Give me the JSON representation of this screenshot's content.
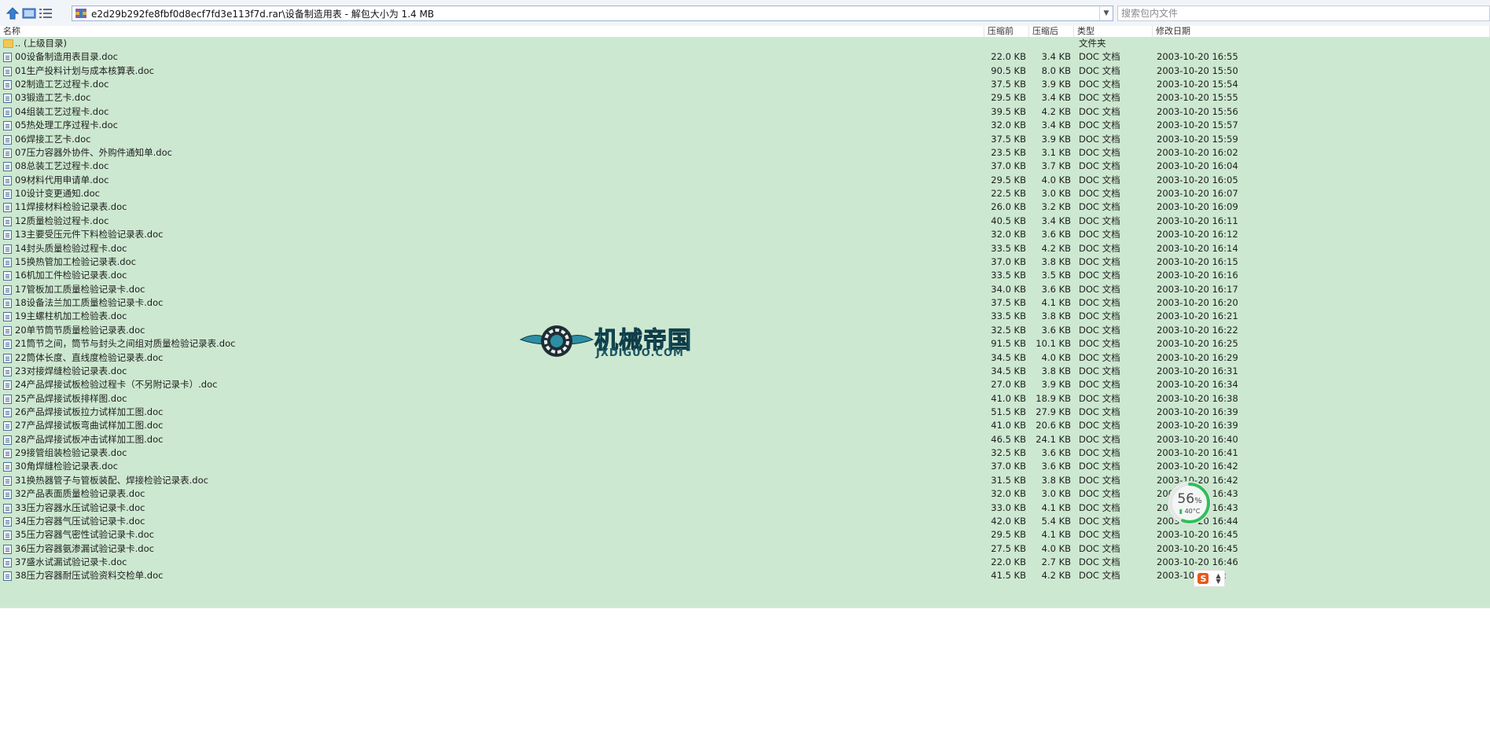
{
  "toolbar": {
    "up_icon": "arrow-up-icon",
    "view_icon": "thumbnail-view-icon",
    "list_icon": "list-view-icon"
  },
  "address": {
    "icon": "rar-archive-icon",
    "path": "e2d29b292fe8fbf0d8ecf7fd3e113f7d.rar\\设备制造用表 - 解包大小为 1.4 MB"
  },
  "search": {
    "placeholder": "搜索包内文件"
  },
  "columns": {
    "name": "名称",
    "before": "压缩前",
    "after": "压缩后",
    "type": "类型",
    "date": "修改日期"
  },
  "parent_row": {
    "name": ".. (上级目录)",
    "type": "文件夹"
  },
  "files": [
    {
      "name": "00设备制造用表目录.doc",
      "before": "22.0 KB",
      "after": "3.4 KB",
      "type": "DOC 文档",
      "date": "2003-10-20 16:55"
    },
    {
      "name": "01生产投料计划与成本核算表.doc",
      "before": "90.5 KB",
      "after": "8.0 KB",
      "type": "DOC 文档",
      "date": "2003-10-20 15:50"
    },
    {
      "name": "02制造工艺过程卡.doc",
      "before": "37.5 KB",
      "after": "3.9 KB",
      "type": "DOC 文档",
      "date": "2003-10-20 15:54"
    },
    {
      "name": "03锻造工艺卡.doc",
      "before": "29.5 KB",
      "after": "3.4 KB",
      "type": "DOC 文档",
      "date": "2003-10-20 15:55"
    },
    {
      "name": "04组装工艺过程卡.doc",
      "before": "39.5 KB",
      "after": "4.2 KB",
      "type": "DOC 文档",
      "date": "2003-10-20 15:56"
    },
    {
      "name": "05热处理工序过程卡.doc",
      "before": "32.0 KB",
      "after": "3.4 KB",
      "type": "DOC 文档",
      "date": "2003-10-20 15:57"
    },
    {
      "name": "06焊接工艺卡.doc",
      "before": "37.5 KB",
      "after": "3.9 KB",
      "type": "DOC 文档",
      "date": "2003-10-20 15:59"
    },
    {
      "name": "07压力容器外协件、外购件通知单.doc",
      "before": "23.5 KB",
      "after": "3.1 KB",
      "type": "DOC 文档",
      "date": "2003-10-20 16:02"
    },
    {
      "name": "08总装工艺过程卡.doc",
      "before": "37.0 KB",
      "after": "3.7 KB",
      "type": "DOC 文档",
      "date": "2003-10-20 16:04"
    },
    {
      "name": "09材料代用申请单.doc",
      "before": "29.5 KB",
      "after": "4.0 KB",
      "type": "DOC 文档",
      "date": "2003-10-20 16:05"
    },
    {
      "name": "10设计变更通知.doc",
      "before": "22.5 KB",
      "after": "3.0 KB",
      "type": "DOC 文档",
      "date": "2003-10-20 16:07"
    },
    {
      "name": "11焊接材料检验记录表.doc",
      "before": "26.0 KB",
      "after": "3.2 KB",
      "type": "DOC 文档",
      "date": "2003-10-20 16:09"
    },
    {
      "name": "12质量检验过程卡.doc",
      "before": "40.5 KB",
      "after": "3.4 KB",
      "type": "DOC 文档",
      "date": "2003-10-20 16:11"
    },
    {
      "name": "13主要受压元件下料检验记录表.doc",
      "before": "32.0 KB",
      "after": "3.6 KB",
      "type": "DOC 文档",
      "date": "2003-10-20 16:12"
    },
    {
      "name": "14封头质量检验过程卡.doc",
      "before": "33.5 KB",
      "after": "4.2 KB",
      "type": "DOC 文档",
      "date": "2003-10-20 16:14"
    },
    {
      "name": "15换热管加工检验记录表.doc",
      "before": "37.0 KB",
      "after": "3.8 KB",
      "type": "DOC 文档",
      "date": "2003-10-20 16:15"
    },
    {
      "name": "16机加工件检验记录表.doc",
      "before": "33.5 KB",
      "after": "3.5 KB",
      "type": "DOC 文档",
      "date": "2003-10-20 16:16"
    },
    {
      "name": "17管板加工质量检验记录卡.doc",
      "before": "34.0 KB",
      "after": "3.6 KB",
      "type": "DOC 文档",
      "date": "2003-10-20 16:17"
    },
    {
      "name": "18设备法兰加工质量检验记录卡.doc",
      "before": "37.5 KB",
      "after": "4.1 KB",
      "type": "DOC 文档",
      "date": "2003-10-20 16:20"
    },
    {
      "name": "19主螺柱机加工检验表.doc",
      "before": "33.5 KB",
      "after": "3.8 KB",
      "type": "DOC 文档",
      "date": "2003-10-20 16:21"
    },
    {
      "name": "20单节筒节质量检验记录表.doc",
      "before": "32.5 KB",
      "after": "3.6 KB",
      "type": "DOC 文档",
      "date": "2003-10-20 16:22"
    },
    {
      "name": "21筒节之间，筒节与封头之间组对质量检验记录表.doc",
      "before": "91.5 KB",
      "after": "10.1 KB",
      "type": "DOC 文档",
      "date": "2003-10-20 16:25"
    },
    {
      "name": "22筒体长度、直线度检验记录表.doc",
      "before": "34.5 KB",
      "after": "4.0 KB",
      "type": "DOC 文档",
      "date": "2003-10-20 16:29"
    },
    {
      "name": "23对接焊缝检验记录表.doc",
      "before": "34.5 KB",
      "after": "3.8 KB",
      "type": "DOC 文档",
      "date": "2003-10-20 16:31"
    },
    {
      "name": "24产品焊接试板检验过程卡（不另附记录卡）.doc",
      "before": "27.0 KB",
      "after": "3.9 KB",
      "type": "DOC 文档",
      "date": "2003-10-20 16:34"
    },
    {
      "name": "25产品焊接试板排样图.doc",
      "before": "41.0 KB",
      "after": "18.9 KB",
      "type": "DOC 文档",
      "date": "2003-10-20 16:38"
    },
    {
      "name": "26产品焊接试板拉力试样加工图.doc",
      "before": "51.5 KB",
      "after": "27.9 KB",
      "type": "DOC 文档",
      "date": "2003-10-20 16:39"
    },
    {
      "name": "27产品焊接试板弯曲试样加工图.doc",
      "before": "41.0 KB",
      "after": "20.6 KB",
      "type": "DOC 文档",
      "date": "2003-10-20 16:39"
    },
    {
      "name": "28产品焊接试板冲击试样加工图.doc",
      "before": "46.5 KB",
      "after": "24.1 KB",
      "type": "DOC 文档",
      "date": "2003-10-20 16:40"
    },
    {
      "name": "29接管组装检验记录表.doc",
      "before": "32.5 KB",
      "after": "3.6 KB",
      "type": "DOC 文档",
      "date": "2003-10-20 16:41"
    },
    {
      "name": "30角焊缝检验记录表.doc",
      "before": "37.0 KB",
      "after": "3.6 KB",
      "type": "DOC 文档",
      "date": "2003-10-20 16:42"
    },
    {
      "name": "31换热器管子与管板装配、焊接检验记录表.doc",
      "before": "31.5 KB",
      "after": "3.8 KB",
      "type": "DOC 文档",
      "date": "2003-10-20 16:42"
    },
    {
      "name": "32产品表面质量检验记录表.doc",
      "before": "32.0 KB",
      "after": "3.0 KB",
      "type": "DOC 文档",
      "date": "2003-10-20 16:43"
    },
    {
      "name": "33压力容器水压试验记录卡.doc",
      "before": "33.0 KB",
      "after": "4.1 KB",
      "type": "DOC 文档",
      "date": "2003-10-20 16:43"
    },
    {
      "name": "34压力容器气压试验记录卡.doc",
      "before": "42.0 KB",
      "after": "5.4 KB",
      "type": "DOC 文档",
      "date": "2003-10-20 16:44"
    },
    {
      "name": "35压力容器气密性试验记录卡.doc",
      "before": "29.5 KB",
      "after": "4.1 KB",
      "type": "DOC 文档",
      "date": "2003-10-20 16:45"
    },
    {
      "name": "36压力容器氨渗漏试验记录卡.doc",
      "before": "27.5 KB",
      "after": "4.0 KB",
      "type": "DOC 文档",
      "date": "2003-10-20 16:45"
    },
    {
      "name": "37盛水试漏试验记录卡.doc",
      "before": "22.0 KB",
      "after": "2.7 KB",
      "type": "DOC 文档",
      "date": "2003-10-20 16:46"
    },
    {
      "name": "38压力容器耐压试验资料交检单.doc",
      "before": "41.5 KB",
      "after": "4.2 KB",
      "type": "DOC 文档",
      "date": "2003-10-20 16:"
    }
  ],
  "watermark": {
    "title": "机械帝国",
    "subtitle": "JXDIGUO.COM",
    "icon": "gear-wings-logo-icon"
  },
  "gauge": {
    "percent_value": 56,
    "percent": "56",
    "percent_unit": "%",
    "temperature": "40°C",
    "icon": "thermometer-icon"
  },
  "ime": {
    "label": "S",
    "icon": "sogou-ime-icon"
  },
  "colors": {
    "list_bg": "#cde8d0",
    "accent": "#2d8ea4",
    "gauge": "#2fbf5a"
  }
}
